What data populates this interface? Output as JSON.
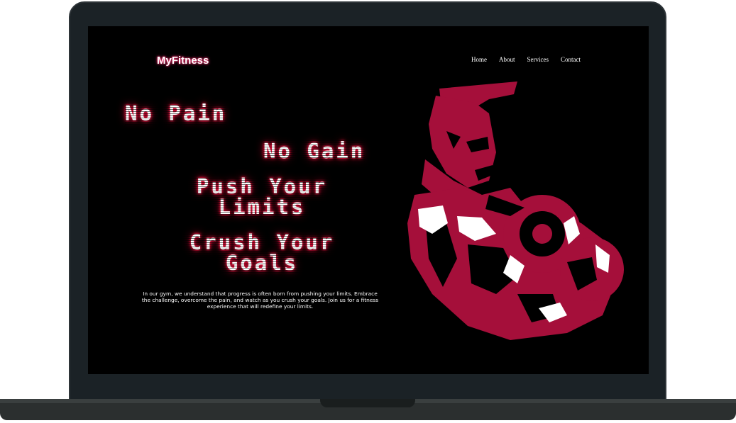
{
  "brand": {
    "name": "MyFitness"
  },
  "nav": {
    "items": [
      "Home",
      "About",
      "Services",
      "Contact"
    ]
  },
  "headlines": {
    "line1": "No Pain",
    "line2": "No Gain",
    "line3a": "Push Your",
    "line3b": "Limits",
    "line4a": "Crush Your",
    "line4b": "Goals"
  },
  "description": "In our gym, we understand that progress is often born from pushing your limits. Embrace the challenge, overcome the pain, and watch as you crush your goals. Join us for a fitness experience that will redefine your limits.",
  "hero": {
    "icon": "bodybuilder-dumbbell-illustration",
    "color": "#a50f3a"
  },
  "colors": {
    "background": "#000000",
    "glow": "#ff1744",
    "accent": "#a50f3a"
  }
}
